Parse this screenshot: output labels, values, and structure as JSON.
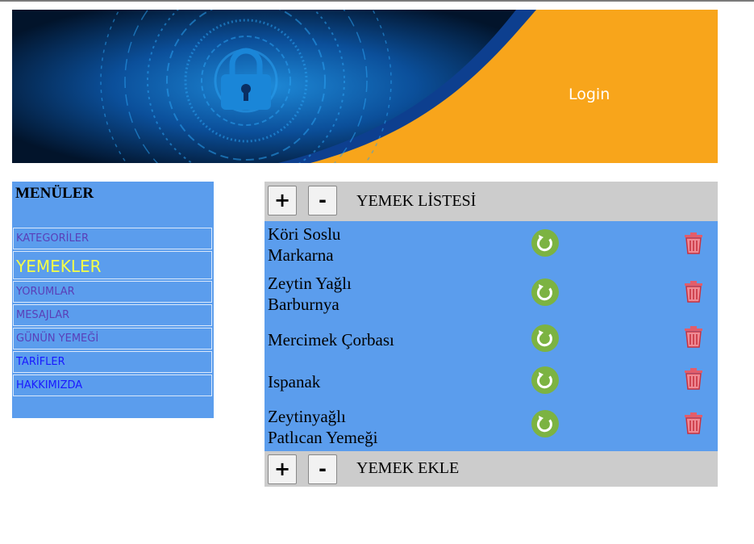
{
  "header": {
    "login_label": "Login"
  },
  "sidebar": {
    "title": "MENÜLER",
    "items": [
      {
        "label": "KATEGORİLER"
      },
      {
        "label": "YEMEKLER"
      },
      {
        "label": "YORUMLAR"
      },
      {
        "label": "MESAJLAR"
      },
      {
        "label": "GÜNÜN YEMEĞİ"
      },
      {
        "label": "TARİFLER"
      },
      {
        "label": "HAKKIMIZDA"
      }
    ]
  },
  "list": {
    "plus_label": "+",
    "minus_label": "-",
    "title": "YEMEK LİSTESİ",
    "rows": [
      {
        "name_line1": "Köri Soslu",
        "name_line2": "Markarna"
      },
      {
        "name_line1": "Zeytin Yağlı",
        "name_line2": "Barburnya"
      },
      {
        "name_line1": "Mercimek Çorbası",
        "name_line2": ""
      },
      {
        "name_line1": "Ispanak",
        "name_line2": ""
      },
      {
        "name_line1": "Zeytinyağlı",
        "name_line2": "Patlıcan Yemeği"
      }
    ]
  },
  "add": {
    "plus_label": "+",
    "minus_label": "-",
    "title": "YEMEK EKLE"
  },
  "colors": {
    "panel_blue": "#5b9ded",
    "bar_gray": "#cccccc",
    "banner_orange": "#f8a51b",
    "refresh_green": "#7cb342",
    "trash_red": "#e35d6a",
    "active_menu": "#f4ff47"
  },
  "icons": [
    "lock-icon",
    "refresh-icon",
    "trash-icon"
  ]
}
